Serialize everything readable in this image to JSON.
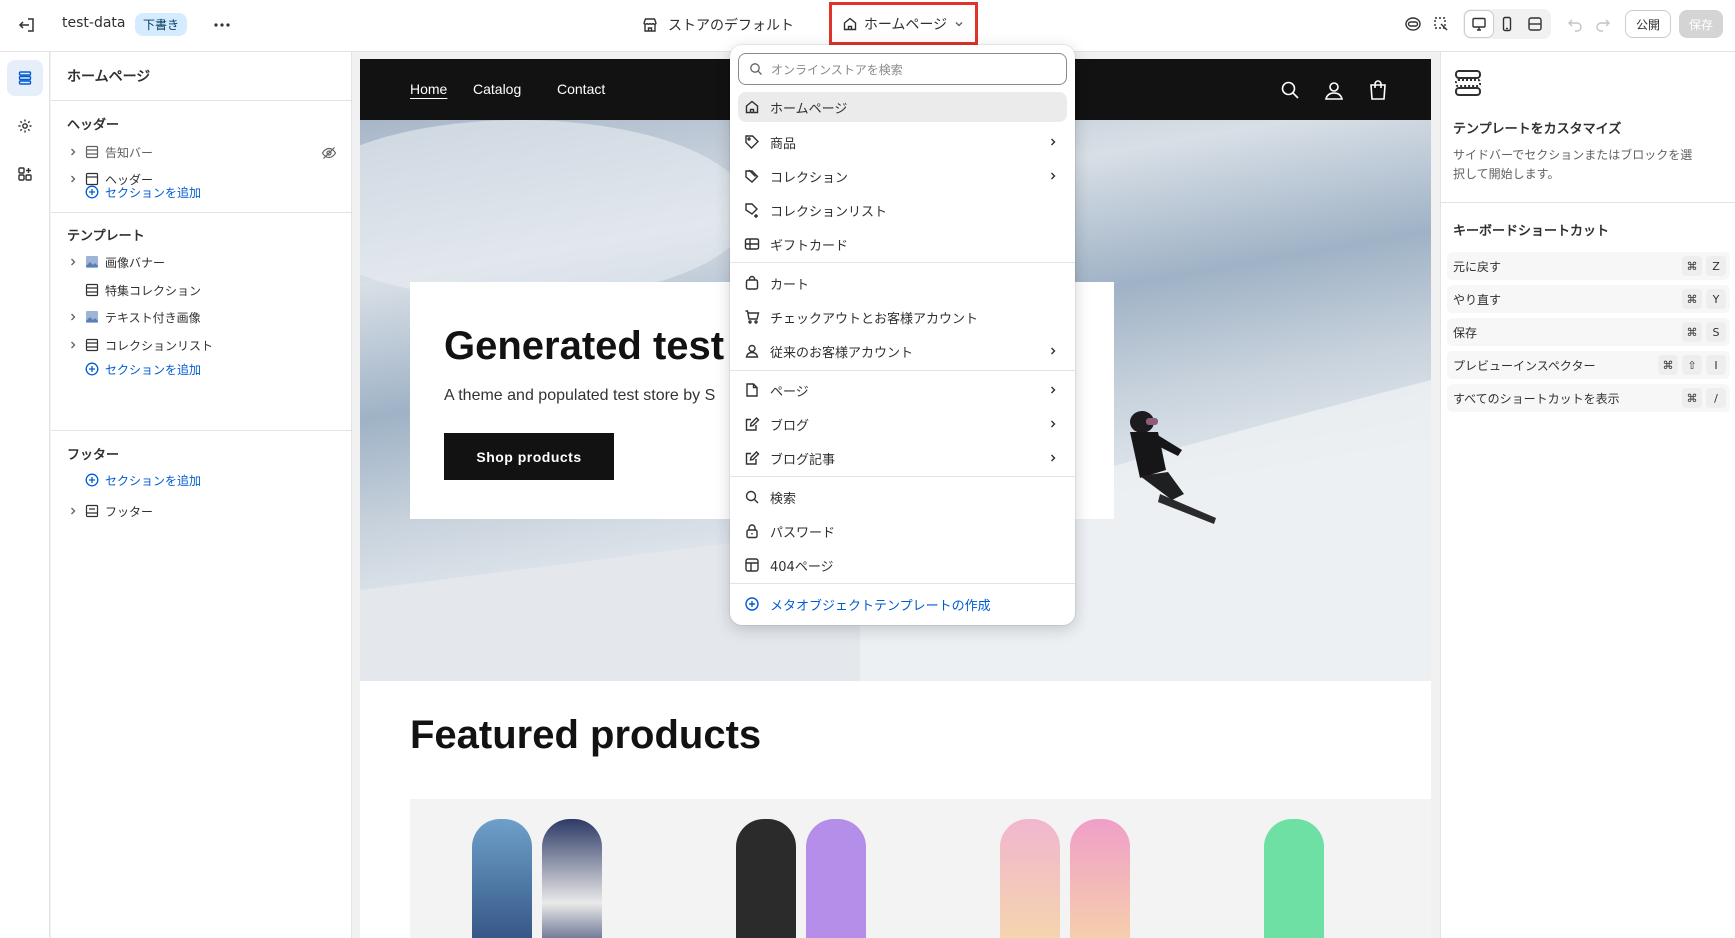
{
  "topbar": {
    "store_name": "test-data",
    "status_badge": "下書き",
    "theme_label": "ストアのデフォルト",
    "page_selector": "ホームページ",
    "publish_label": "公開",
    "save_label": "保存"
  },
  "sidebar": {
    "title": "ホームページ",
    "header_group": {
      "title": "ヘッダー",
      "items": [
        "告知バー",
        "ヘッダー"
      ],
      "add_label": "セクションを追加"
    },
    "template_group": {
      "title": "テンプレート",
      "items": [
        "画像バナー",
        "特集コレクション",
        "テキスト付き画像",
        "コレクションリスト"
      ],
      "add_label": "セクションを追加"
    },
    "footer_group": {
      "title": "フッター",
      "add_label": "セクションを追加",
      "items": [
        "フッター"
      ]
    }
  },
  "dropdown": {
    "search_placeholder": "オンラインストアを検索",
    "items": [
      "ホームページ",
      "商品",
      "コレクション",
      "コレクションリスト",
      "ギフトカード",
      "カート",
      "チェックアウトとお客様アカウント",
      "従来のお客様アカウント",
      "ページ",
      "ブログ",
      "ブログ記事",
      "検索",
      "パスワード",
      "404ページ"
    ],
    "create_label": "メタオブジェクトテンプレートの作成"
  },
  "store": {
    "nav": [
      "Home",
      "Catalog",
      "Contact"
    ],
    "hero_heading": "Generated test",
    "hero_text": "A theme and populated test store by S",
    "hero_button": "Shop products",
    "featured_heading": "Featured products"
  },
  "right_panel": {
    "title": "テンプレートをカスタマイズ",
    "description": "サイドバーでセクションまたはブロックを選択して開始します。",
    "shortcuts_title": "キーボードショートカット",
    "shortcuts": [
      {
        "label": "元に戻す",
        "keys": [
          "⌘",
          "Z"
        ]
      },
      {
        "label": "やり直す",
        "keys": [
          "⌘",
          "Y"
        ]
      },
      {
        "label": "保存",
        "keys": [
          "⌘",
          "S"
        ]
      },
      {
        "label": "プレビューインスペクター",
        "keys": [
          "⌘",
          "⇧",
          "I"
        ]
      },
      {
        "label": "すべてのショートカットを表示",
        "keys": [
          "⌘",
          "/"
        ]
      }
    ]
  },
  "colors": {
    "accent_blue": "#005bd3",
    "highlight_red": "#e0342b",
    "store_nav_bg": "#121212"
  }
}
